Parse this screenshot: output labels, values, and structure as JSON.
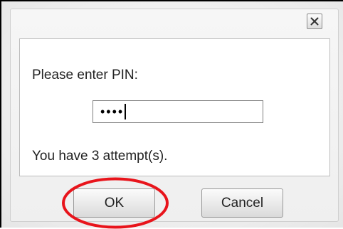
{
  "dialog": {
    "close_icon": "close-icon",
    "prompt_text": "Please enter PIN:",
    "pin_value": "••••",
    "attempts_text": "You have 3 attempt(s).",
    "ok_label": "OK",
    "cancel_label": "Cancel"
  },
  "colors": {
    "highlight_ellipse": "#e8141b",
    "dialog_background": "#f2f2f2",
    "panel_background": "#ffffff"
  }
}
